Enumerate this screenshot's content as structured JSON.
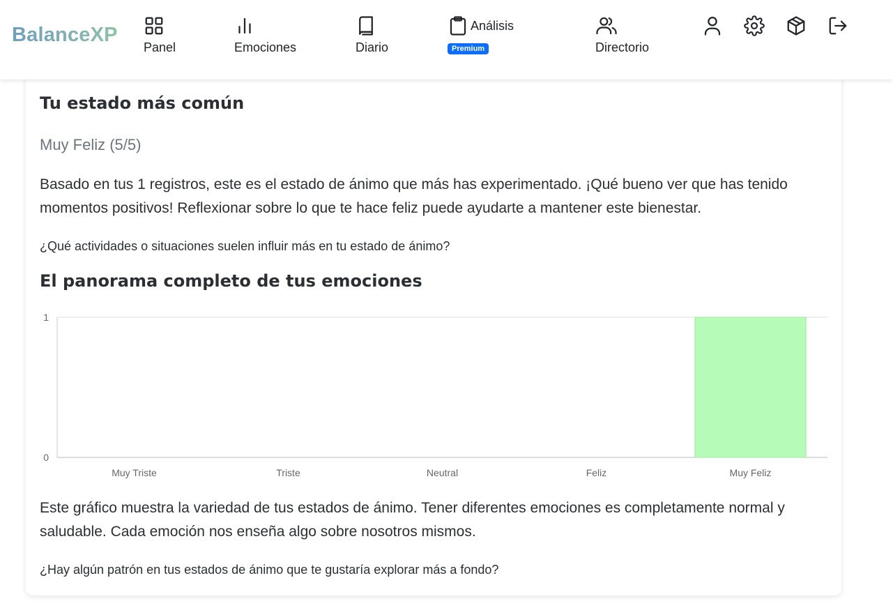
{
  "brand": "BalanceXP",
  "nav": {
    "panel": "Panel",
    "emociones": "Emociones",
    "diario": "Diario",
    "analisis": "Análisis",
    "premium_badge": "Premium",
    "directorio": "Directorio"
  },
  "header_icons": [
    "user-icon",
    "gear-icon",
    "box-icon",
    "logout-icon"
  ],
  "common_state": {
    "heading": "Tu estado más común",
    "value": "Muy Feliz (5/5)",
    "description": "Basado en tus 1 registros, este es el estado de ánimo que más has experimentado. ¡Qué bueno ver que has tenido momentos positivos! Reflexionar sobre lo que te hace feliz puede ayudarte a mantener este bienestar.",
    "question": "¿Qué actividades o situaciones suelen influir más en tu estado de ánimo?"
  },
  "overview": {
    "heading": "El panorama completo de tus emociones",
    "description": "Este gráfico muestra la variedad de tus estados de ánimo. Tener diferentes emociones es completamente normal y saludable. Cada emoción nos enseña algo sobre nosotros mismos.",
    "question": "¿Hay algún patrón en tus estados de ánimo que te gustaría explorar más a fondo?"
  },
  "chart_data": {
    "type": "bar",
    "categories": [
      "Muy Triste",
      "Triste",
      "Neutral",
      "Feliz",
      "Muy Feliz"
    ],
    "values": [
      0,
      0,
      0,
      0,
      1
    ],
    "yticks": [
      "0",
      "1"
    ],
    "ylim": [
      0,
      1
    ],
    "grid": true,
    "bar_color": "#b6fbb7",
    "bar_border": "#9ee8a0"
  },
  "colors": {
    "accent": "#0d6efd",
    "brand_start": "#6f9fc0",
    "brand_end": "#8cc4a3",
    "muted_text": "#6c757d"
  }
}
